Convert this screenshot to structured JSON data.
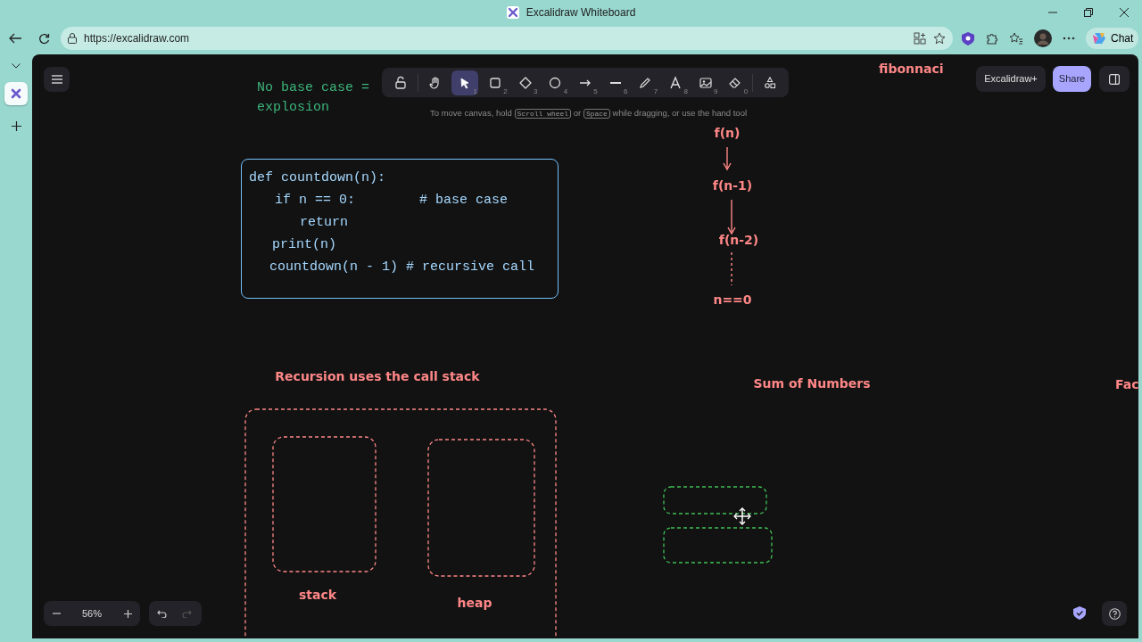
{
  "window": {
    "title": "Excalidraw Whiteboard"
  },
  "browser": {
    "url": "https://excalidraw.com",
    "chat_label": "Chat"
  },
  "toolbar": {
    "tools": [
      {
        "kind": "lock",
        "selected": false
      },
      {
        "kind": "hand",
        "selected": false
      },
      {
        "kind": "selection",
        "key": "1",
        "selected": true
      },
      {
        "kind": "rectangle",
        "key": "2",
        "selected": false
      },
      {
        "kind": "diamond",
        "key": "3",
        "selected": false
      },
      {
        "kind": "ellipse",
        "key": "4",
        "selected": false
      },
      {
        "kind": "arrow",
        "key": "5",
        "selected": false
      },
      {
        "kind": "line",
        "key": "6",
        "selected": false
      },
      {
        "kind": "pencil",
        "key": "7",
        "selected": false
      },
      {
        "kind": "text",
        "key": "8",
        "selected": false
      },
      {
        "kind": "image",
        "key": "9",
        "selected": false
      },
      {
        "kind": "eraser",
        "key": "0",
        "selected": false
      },
      {
        "kind": "shapes",
        "selected": false
      }
    ]
  },
  "hint": {
    "parts": [
      {
        "kind": "text",
        "text": "To move canvas, hold"
      },
      {
        "kind": "key",
        "text": "Scroll wheel"
      },
      {
        "kind": "text",
        "text": "or"
      },
      {
        "kind": "key",
        "text": "Space"
      },
      {
        "kind": "text",
        "text": "while dragging, or use the hand tool"
      }
    ]
  },
  "top_right": {
    "plus_label": "Excalidraw+",
    "share_label": "Share"
  },
  "notes": [
    {
      "text": "No base case ="
    },
    {
      "text": "explosion"
    }
  ],
  "code_block": {
    "lines": [
      "def countdown(n):",
      "if n == 0:        # base case",
      "return",
      "print(n)",
      "countdown(n - 1) # recursive call"
    ]
  },
  "fibonacci": {
    "title": "fibonnaci",
    "nodes": [
      "f(n)",
      "f(n-1)",
      "f(n-2)",
      "n==0"
    ],
    "links": [
      {
        "kind": "arrow"
      },
      {
        "kind": "arrow"
      },
      {
        "kind": "dashed"
      }
    ]
  },
  "labels": [
    {
      "text": "Recursion uses the call stack"
    },
    {
      "text": "Sum of Numbers"
    },
    {
      "text": "Fac"
    },
    {
      "text": "stack"
    },
    {
      "text": "heap"
    }
  ],
  "shapes": [
    {
      "color": "#ff8787"
    },
    {
      "color": "#ff8787"
    },
    {
      "color": "#ff8787"
    },
    {
      "color": "#40c057"
    },
    {
      "color": "#40c057"
    }
  ],
  "zoom": {
    "value": "56%"
  }
}
